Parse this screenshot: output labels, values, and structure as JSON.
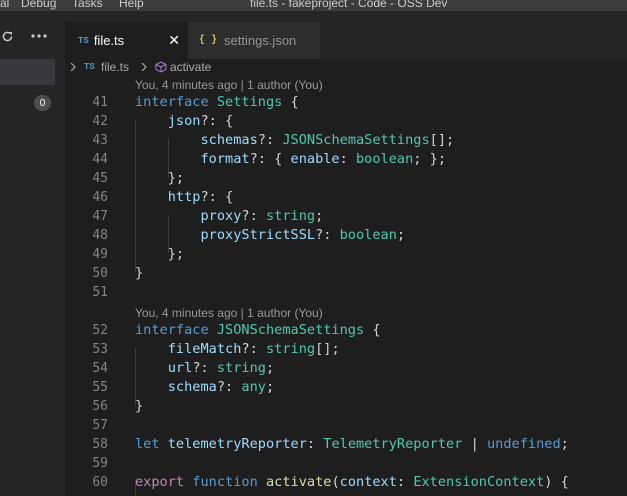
{
  "titlebar": {
    "menu": [
      {
        "id": "view",
        "label": "al"
      },
      {
        "id": "debug",
        "label": "Debug"
      },
      {
        "id": "tasks",
        "label": "Tasks"
      },
      {
        "id": "help",
        "label": "Help"
      }
    ],
    "window_title": "file.ts - fakeproject - Code - OSS Dev"
  },
  "sidebar": {
    "refresh_icon": "refresh-icon",
    "more_icon": "more-actions-icon",
    "badge_count": "0"
  },
  "tabs": [
    {
      "badge": "TS",
      "label": "file.ts",
      "close": "✕",
      "active": true
    },
    {
      "badge": "{ }",
      "label": "settings.json",
      "active": false
    }
  ],
  "breadcrumb": {
    "file_badge": "TS",
    "file": "file.ts",
    "symbol": "activate"
  },
  "editor": {
    "lens_1": "You, 4 minutes ago | 1 author (You)",
    "lens_2": "You, 4 minutes ago | 1 author (You)",
    "line_numbers": [
      "41",
      "42",
      "43",
      "44",
      "45",
      "46",
      "47",
      "48",
      "49",
      "50",
      "51",
      "52",
      "53",
      "54",
      "55",
      "56",
      "57",
      "58",
      "59",
      "60"
    ]
  },
  "colors": {
    "keyword": "#569cd6",
    "type": "#4ec9b0",
    "property": "#9cdcfe",
    "function": "#dcdcaa",
    "control": "#c586c0",
    "text": "#d4d4d4"
  }
}
